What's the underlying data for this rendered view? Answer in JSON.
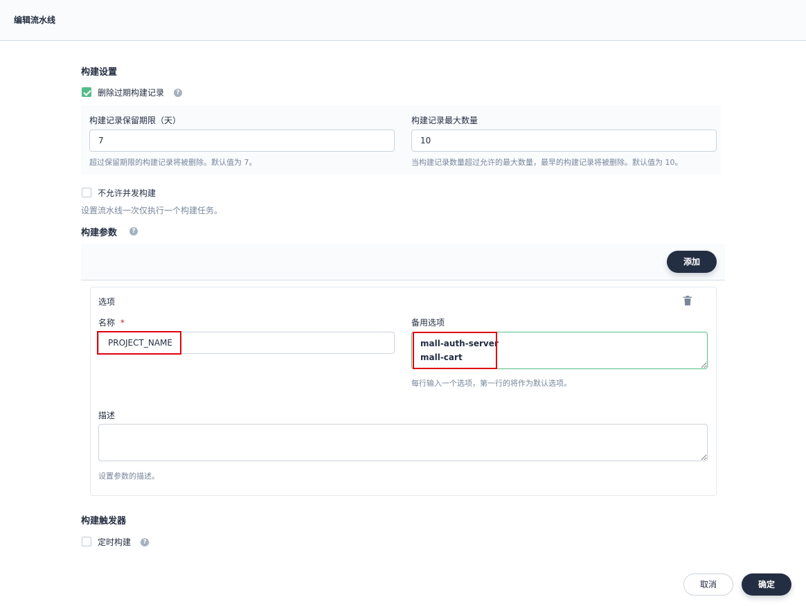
{
  "header": {
    "title": "编辑流水线"
  },
  "build_settings": {
    "title": "构建设置",
    "discard_old": {
      "label": "删除过期构建记录",
      "checked": true,
      "help": "?"
    },
    "retention_days": {
      "label": "构建记录保留期限（天）",
      "value": "7",
      "hint": "超过保留期限的构建记录将被删除。默认值为 7。"
    },
    "max_records": {
      "label": "构建记录最大数量",
      "value": "10",
      "hint": "当构建记录数量超过允许的最大数量，最早的构建记录将被删除。默认值为 10。"
    },
    "no_concurrent": {
      "label": "不允许并发构建",
      "checked": false,
      "hint": "设置流水线一次仅执行一个构建任务。"
    }
  },
  "build_params": {
    "title": "构建参数",
    "help": "?",
    "add_label": "添加",
    "param": {
      "type": "选项",
      "name_label": "名称",
      "required_mark": "*",
      "name_value": "PROJECT_NAME",
      "options_label": "备用选项",
      "options_value": "mall-auth-server\nmall-cart",
      "options_hint": "每行输入一个选项，第一行的将作为默认选项。",
      "desc_label": "描述",
      "desc_value": "",
      "desc_hint": "设置参数的描述。"
    }
  },
  "build_triggers": {
    "title": "构建触发器",
    "scheduled": {
      "label": "定时构建",
      "checked": false,
      "help": "?"
    }
  },
  "footer": {
    "cancel_label": "取消",
    "ok_label": "确定"
  },
  "colors": {
    "primary": "#242e42",
    "check": "#55bc8a",
    "highlight": "#e0000b"
  }
}
